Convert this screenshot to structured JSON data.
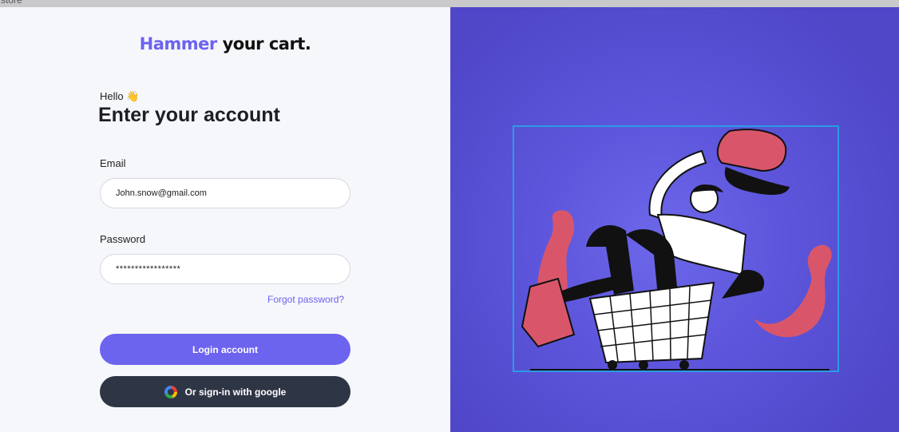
{
  "window": {
    "title_fragment": "store"
  },
  "brand": {
    "accent": "Hammer",
    "rest": "your cart."
  },
  "greeting": {
    "hello": "Hello",
    "wave": "👋",
    "title": "Enter your account"
  },
  "form": {
    "email_label": "Email",
    "email_value": "John.snow@gmail.com",
    "password_label": "Password",
    "password_value": "*****************",
    "forgot": "Forgot password?",
    "login_button": "Login account",
    "google_button": "Or sign-in with google"
  },
  "colors": {
    "accent": "#6c63ef",
    "panel": "#5a53d6",
    "dark_button": "#2e3545",
    "highlight": "#2b9be3",
    "pink": "#d9566a"
  },
  "illustration": {
    "subject": "person-in-shopping-cart-illustration"
  }
}
